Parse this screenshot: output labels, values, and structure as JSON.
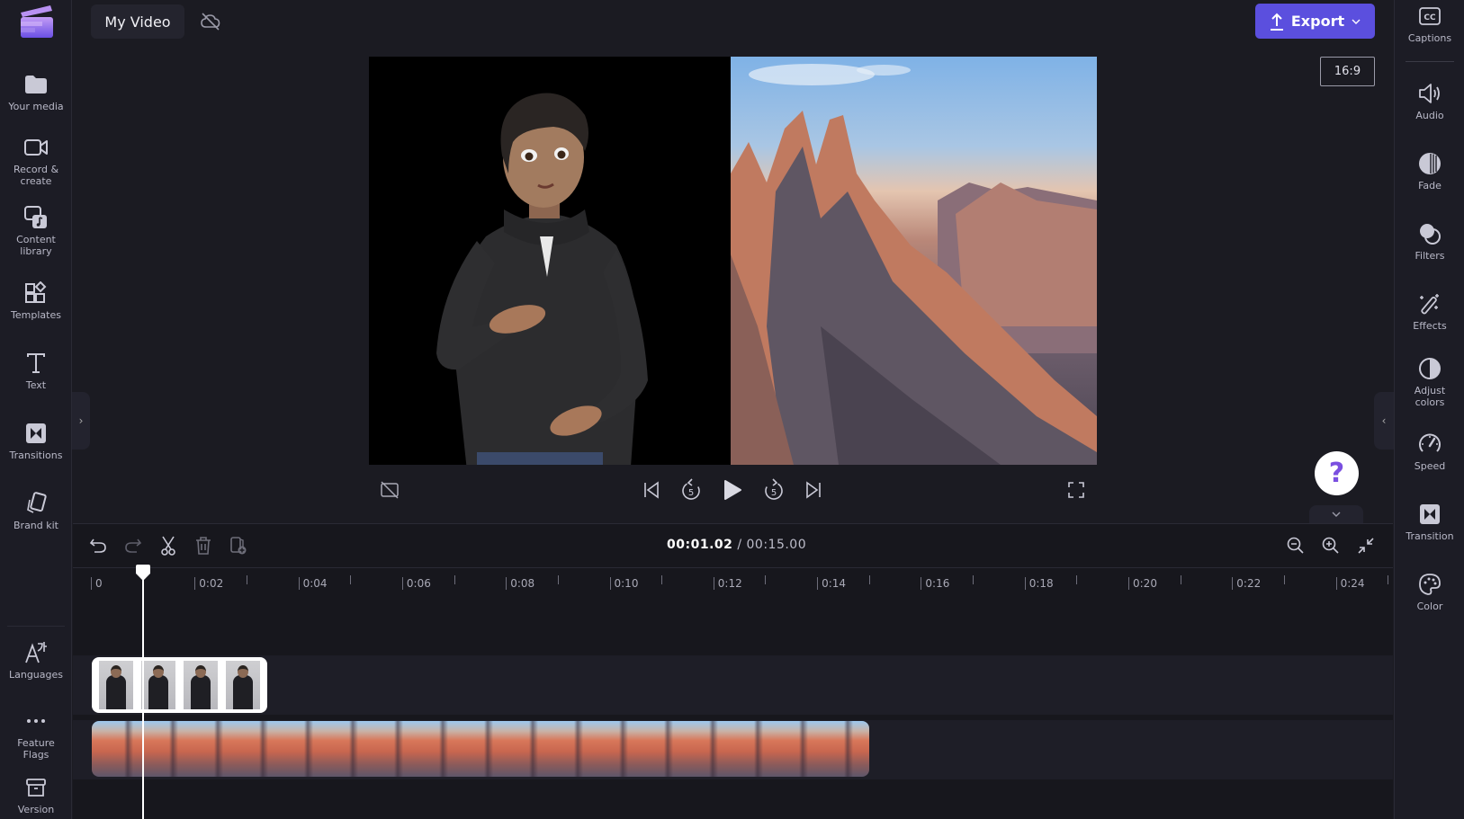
{
  "app": {
    "project_title": "My Video",
    "cloud_status_icon": "cloud-off-icon",
    "export_label": "Export",
    "aspect_ratio": "16:9",
    "brand_color": "#5b4fde"
  },
  "left_sidebar": {
    "items": [
      {
        "label": "Your media",
        "icon": "folder-icon"
      },
      {
        "label": "Record & create",
        "icon": "camera-icon"
      },
      {
        "label": "Content library",
        "icon": "content-library-icon"
      },
      {
        "label": "Templates",
        "icon": "templates-icon"
      },
      {
        "label": "Text",
        "icon": "text-icon"
      },
      {
        "label": "Transitions",
        "icon": "transitions-icon"
      },
      {
        "label": "Brand kit",
        "icon": "brand-kit-icon"
      }
    ],
    "bottom_items": [
      {
        "label": "Languages",
        "icon": "languages-icon"
      },
      {
        "label": "Feature Flags",
        "icon": "more-icon"
      },
      {
        "label": "Version",
        "icon": "archive-icon"
      }
    ]
  },
  "right_sidebar": {
    "items": [
      {
        "label": "Captions",
        "icon": "captions-icon"
      },
      {
        "label": "Audio",
        "icon": "speaker-icon"
      },
      {
        "label": "Fade",
        "icon": "fade-icon"
      },
      {
        "label": "Filters",
        "icon": "filters-icon"
      },
      {
        "label": "Effects",
        "icon": "magic-wand-icon"
      },
      {
        "label": "Adjust colors",
        "icon": "contrast-icon"
      },
      {
        "label": "Speed",
        "icon": "speedometer-icon"
      },
      {
        "label": "Transition",
        "icon": "transition-icon"
      },
      {
        "label": "Color",
        "icon": "palette-icon"
      }
    ]
  },
  "player": {
    "controls": [
      "captions-off",
      "skip-to-start",
      "rewind-5",
      "play",
      "forward-5",
      "skip-to-end",
      "fullscreen"
    ],
    "rewind_seconds": "5",
    "forward_seconds": "5",
    "help_label": "?"
  },
  "timeline": {
    "current_time": "00:01.02",
    "separator": " / ",
    "total_time": "00:15.00",
    "ruler_labels": [
      "0",
      "0:02",
      "0:04",
      "0:06",
      "0:08",
      "0:10",
      "0:12",
      "0:14",
      "0:16",
      "0:18",
      "0:20",
      "0:22",
      "0:24"
    ],
    "tools": [
      "undo",
      "redo",
      "split",
      "delete",
      "add-to-media"
    ],
    "zoom_tools": [
      "zoom-out",
      "zoom-in",
      "fit-to-screen"
    ],
    "tracks": [
      {
        "name": "avatar-clip",
        "thumbnail_count": 4
      },
      {
        "name": "mountain-clip"
      }
    ]
  }
}
